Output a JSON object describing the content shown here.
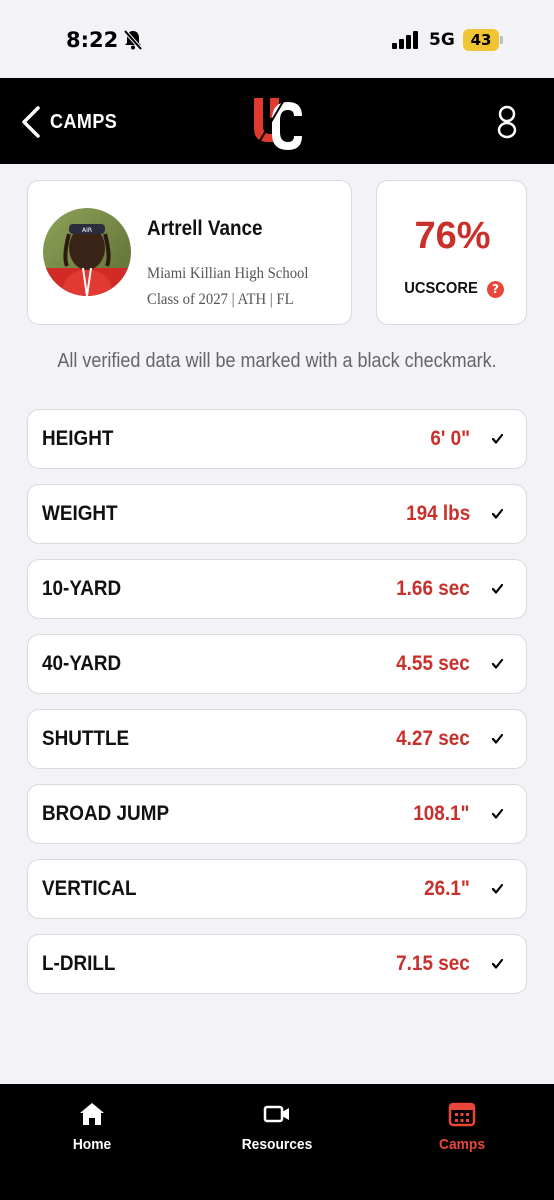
{
  "status_bar": {
    "time": "8:22",
    "network": "5G",
    "battery": "43"
  },
  "nav": {
    "back_label": "CAMPS",
    "logo_text": "UC"
  },
  "player": {
    "name": "Artrell Vance",
    "school": "Miami Killian High School",
    "class_info": "Class of 2027 | ATH | FL"
  },
  "score": {
    "value": "76%",
    "label": "UCSCORE",
    "help": "?"
  },
  "notice": "All verified data will be marked with a black checkmark.",
  "metrics": [
    {
      "label": "HEIGHT",
      "value": "6' 0\"",
      "verified": true
    },
    {
      "label": "WEIGHT",
      "value": "194 lbs",
      "verified": true
    },
    {
      "label": "10-YARD",
      "value": "1.66 sec",
      "verified": true
    },
    {
      "label": "40-YARD",
      "value": "4.55 sec",
      "verified": true
    },
    {
      "label": "SHUTTLE",
      "value": "4.27 sec",
      "verified": true
    },
    {
      "label": "BROAD JUMP",
      "value": "108.1\"",
      "verified": true
    },
    {
      "label": "VERTICAL",
      "value": "26.1\"",
      "verified": true
    },
    {
      "label": "L-DRILL",
      "value": "7.15 sec",
      "verified": true
    }
  ],
  "tabs": [
    {
      "label": "Home",
      "icon": "home-icon",
      "active": false
    },
    {
      "label": "Resources",
      "icon": "video-camera-icon",
      "active": false
    },
    {
      "label": "Camps",
      "icon": "calendar-icon",
      "active": true
    }
  ],
  "colors": {
    "accent": "#c9302c",
    "tab_active": "#e8473a",
    "battery": "#f0c531"
  }
}
